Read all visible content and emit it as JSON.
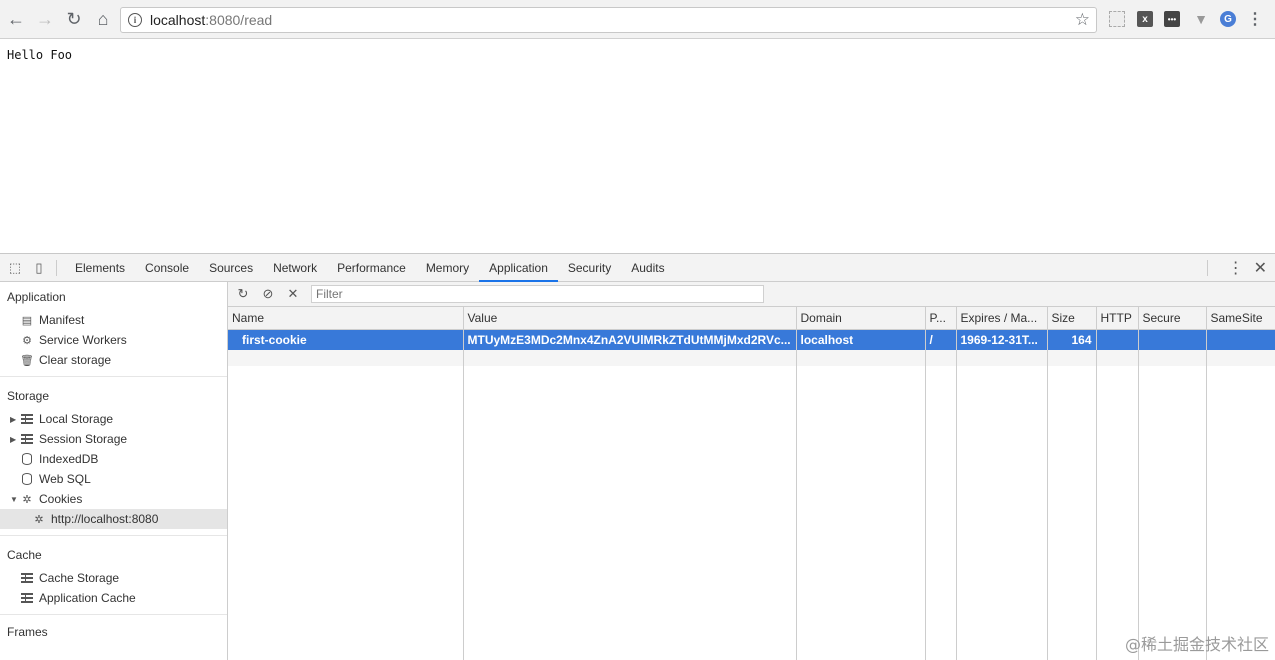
{
  "browser": {
    "url_host": "localhost",
    "url_rest": ":8080/read",
    "back_icon": "arrow-left-icon",
    "forward_icon": "arrow-right-icon",
    "reload_icon": "reload-icon",
    "home_icon": "home-icon"
  },
  "page": {
    "text": "Hello Foo"
  },
  "devtools": {
    "tabs": [
      "Elements",
      "Console",
      "Sources",
      "Network",
      "Performance",
      "Memory",
      "Application",
      "Security",
      "Audits"
    ],
    "active_tab": "Application",
    "sidebar": {
      "application_head": "Application",
      "manifest": "Manifest",
      "service_workers": "Service Workers",
      "clear_storage": "Clear storage",
      "storage_head": "Storage",
      "local_storage": "Local Storage",
      "session_storage": "Session Storage",
      "indexeddb": "IndexedDB",
      "web_sql": "Web SQL",
      "cookies": "Cookies",
      "cookie_origin": "http://localhost:8080",
      "cache_head": "Cache",
      "cache_storage": "Cache Storage",
      "application_cache": "Application Cache",
      "frames_head": "Frames"
    },
    "filter_placeholder": "Filter",
    "columns": [
      "Name",
      "Value",
      "Domain",
      "P...",
      "Expires / Ma...",
      "Size",
      "HTTP",
      "Secure",
      "SameSite"
    ],
    "cookie_row": {
      "name": "first-cookie",
      "value": "MTUyMzE3MDc2Mnx4ZnA2VUlMRkZTdUtMMjMxd2RVc...",
      "domain": "localhost",
      "path": "/",
      "expires": "1969-12-31T...",
      "size": "164",
      "http": "",
      "secure": "",
      "samesite": ""
    }
  },
  "watermark": "@稀土掘金技术社区"
}
